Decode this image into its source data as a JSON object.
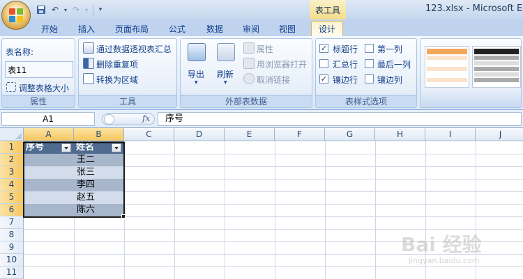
{
  "titlebar": {
    "context_tab_title": "表工具",
    "window_title": "123.xlsx - Microsoft Exc"
  },
  "tabs": [
    {
      "label": "开始"
    },
    {
      "label": "插入"
    },
    {
      "label": "页面布局"
    },
    {
      "label": "公式"
    },
    {
      "label": "数据"
    },
    {
      "label": "审阅"
    },
    {
      "label": "视图"
    },
    {
      "label": "设计"
    }
  ],
  "ribbon": {
    "properties": {
      "tablename_label": "表名称:",
      "tablename_value": "表11",
      "resize_label": "调整表格大小",
      "group_label": "属性"
    },
    "tools": {
      "pivot_label": "通过数据透视表汇总",
      "remove_dup_label": "删除重复项",
      "convert_label": "转换为区域",
      "group_label": "工具"
    },
    "external": {
      "export_label": "导出",
      "refresh_label": "刷新",
      "properties_label": "属性",
      "open_browser_label": "用浏览器打开",
      "unlink_label": "取消链接",
      "group_label": "外部表数据"
    },
    "style_options": {
      "header_row": {
        "label": "标题行",
        "checked": true
      },
      "total_row": {
        "label": "汇总行",
        "checked": false
      },
      "banded_rows": {
        "label": "镶边行",
        "checked": true
      },
      "first_column": {
        "label": "第一列",
        "checked": false
      },
      "last_column": {
        "label": "最后一列",
        "checked": false
      },
      "banded_columns": {
        "label": "镶边列",
        "checked": false
      },
      "group_label": "表样式选项"
    }
  },
  "formula_bar": {
    "name_box": "A1",
    "fx_symbol": "fx",
    "content": "序号"
  },
  "sheet": {
    "columns": [
      "A",
      "B",
      "C",
      "D",
      "E",
      "F",
      "G",
      "H",
      "I",
      "J"
    ],
    "rows": [
      "1",
      "2",
      "3",
      "4",
      "5",
      "6",
      "7",
      "8",
      "9",
      "10",
      "11"
    ],
    "table": {
      "headers": [
        "序号",
        "姓名"
      ],
      "names": [
        "王二",
        "张三",
        "李四",
        "赵五",
        "陈六"
      ]
    }
  },
  "watermark": {
    "text": "Bai 经验",
    "sub": "jingyan.baidu.com"
  },
  "colors": {
    "table_header": "#4f6b8f",
    "band_dark": "#a7b6cb",
    "band_light": "#d3dcea",
    "ribbon_text": "#15428b"
  }
}
